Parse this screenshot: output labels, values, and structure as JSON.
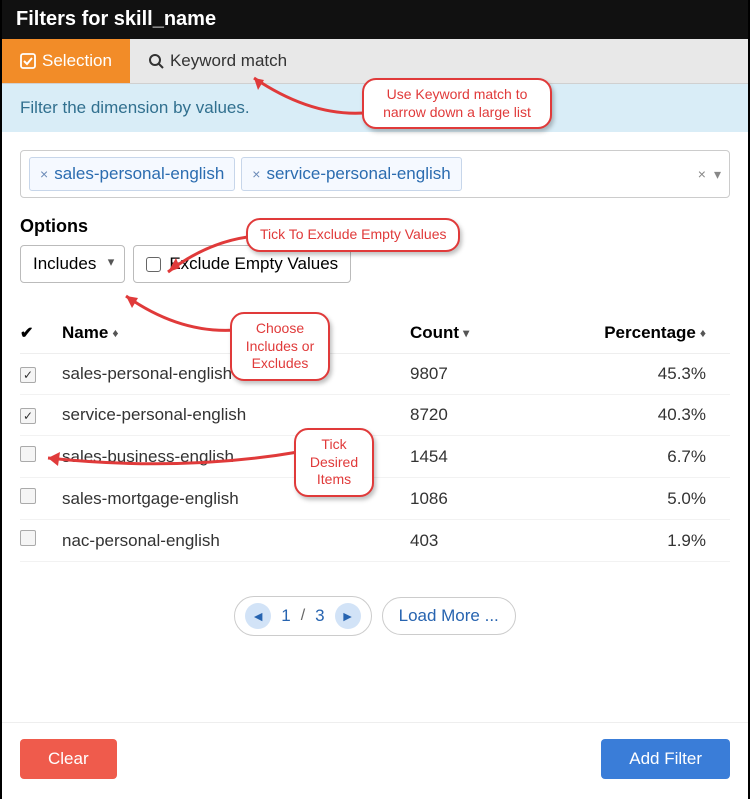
{
  "header": {
    "title": "Filters for skill_name"
  },
  "tabs": {
    "selection": "Selection",
    "keyword": "Keyword match"
  },
  "hint": "Filter the dimension by values.",
  "chips": [
    "sales-personal-english",
    "service-personal-english"
  ],
  "options": {
    "label": "Options",
    "mode": "Includes",
    "exclude_label": "Exclude Empty Values"
  },
  "columns": {
    "name": "Name",
    "count": "Count",
    "pct": "Percentage"
  },
  "rows": [
    {
      "checked": true,
      "name": "sales-personal-english",
      "count": "9807",
      "pct": "45.3%"
    },
    {
      "checked": true,
      "name": "service-personal-english",
      "count": "8720",
      "pct": "40.3%"
    },
    {
      "checked": false,
      "name": "sales-business-english",
      "count": "1454",
      "pct": "6.7%"
    },
    {
      "checked": false,
      "name": "sales-mortgage-english",
      "count": "1086",
      "pct": "5.0%"
    },
    {
      "checked": false,
      "name": "nac-personal-english",
      "count": "403",
      "pct": "1.9%"
    }
  ],
  "pager": {
    "current": "1",
    "sep": "/",
    "total": "3",
    "load_more": "Load More ..."
  },
  "buttons": {
    "clear": "Clear",
    "add": "Add Filter"
  },
  "callouts": {
    "keyword": "Use Keyword match to narrow down a large list",
    "exclude": "Tick To Exclude Empty Values",
    "mode": "Choose Includes or Excludes",
    "tick": "Tick Desired Items"
  }
}
